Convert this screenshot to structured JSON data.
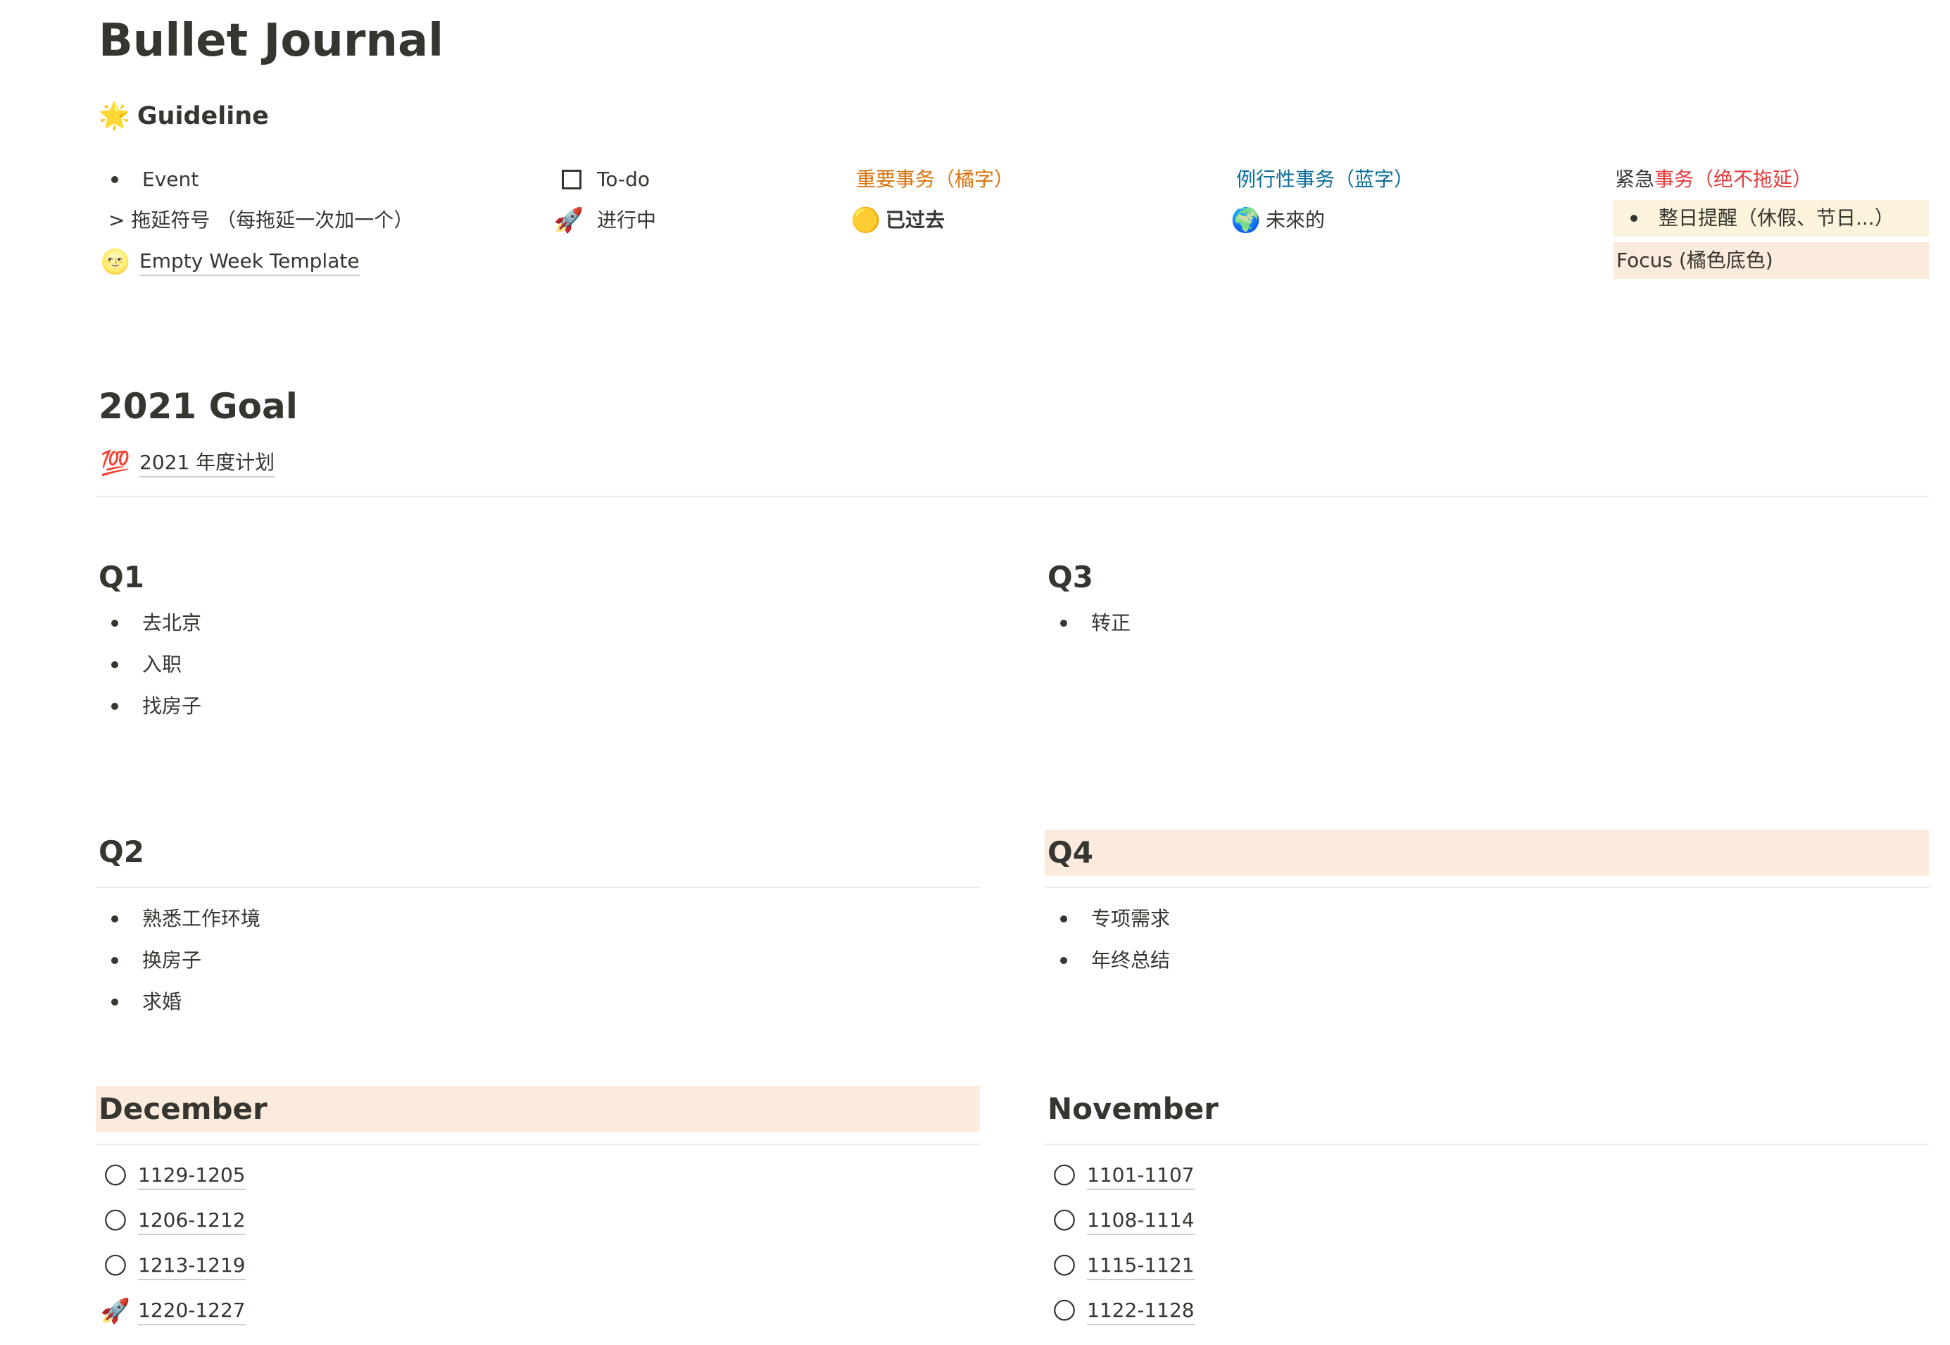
{
  "page": {
    "title": "Bullet Journal"
  },
  "guideline": {
    "heading": "Guideline",
    "heading_icon": "glowing-star",
    "col1": {
      "event": "Event",
      "procrastination": "> 拖延符号 （每拖延一次加一个）",
      "empty_week": "Empty Week Template",
      "empty_week_icon": "moon-face"
    },
    "col2": {
      "todo": "To-do",
      "in_progress": "进行中",
      "in_progress_icon": "rocket"
    },
    "col3": {
      "important": "重要事务（橘字）",
      "past": "已过去",
      "past_icon": "yellow-circle"
    },
    "col4": {
      "routine": "例行性事务（蓝字）",
      "future": "未來的",
      "future_icon": "globe"
    },
    "col5": {
      "urgent_prefix": "紧急",
      "urgent_main": "事务（绝不拖延）",
      "all_day": "整日提醒（休假、节日...）",
      "focus": "Focus (橘色底色)"
    }
  },
  "goal": {
    "heading": "2021 Goal",
    "plan_icon": "hundred-points",
    "plan": "2021 年度计划"
  },
  "quarters": {
    "q1": {
      "label": "Q1",
      "items": [
        "去北京",
        "入职",
        "找房子"
      ]
    },
    "q2": {
      "label": "Q2",
      "items": [
        "熟悉工作环境",
        "换房子",
        "求婚"
      ]
    },
    "q3": {
      "label": "Q3",
      "items": [
        "转正"
      ]
    },
    "q4": {
      "label": "Q4",
      "items": [
        "专项需求",
        "年终总结"
      ]
    }
  },
  "months": {
    "december": {
      "label": "December",
      "weeks": [
        {
          "label": "1129-1205",
          "icon": "star-coin"
        },
        {
          "label": "1206-1212",
          "icon": "star-coin"
        },
        {
          "label": "1213-1219",
          "icon": "star-coin"
        },
        {
          "label": "1220-1227",
          "icon": "rocket"
        }
      ]
    },
    "november": {
      "label": "November",
      "weeks": [
        {
          "label": "1101-1107",
          "icon": "star-coin"
        },
        {
          "label": "1108-1114",
          "icon": "star-coin"
        },
        {
          "label": "1115-1121",
          "icon": "star-coin"
        },
        {
          "label": "1122-1128",
          "icon": "star-coin"
        }
      ]
    }
  },
  "colors": {
    "text": "#37352f",
    "orange_text": "#d9730d",
    "blue_text": "#0b6e99",
    "red_text": "#e03e3e",
    "yellow_background": "#fbf3db",
    "orange_background": "#faebdd"
  }
}
